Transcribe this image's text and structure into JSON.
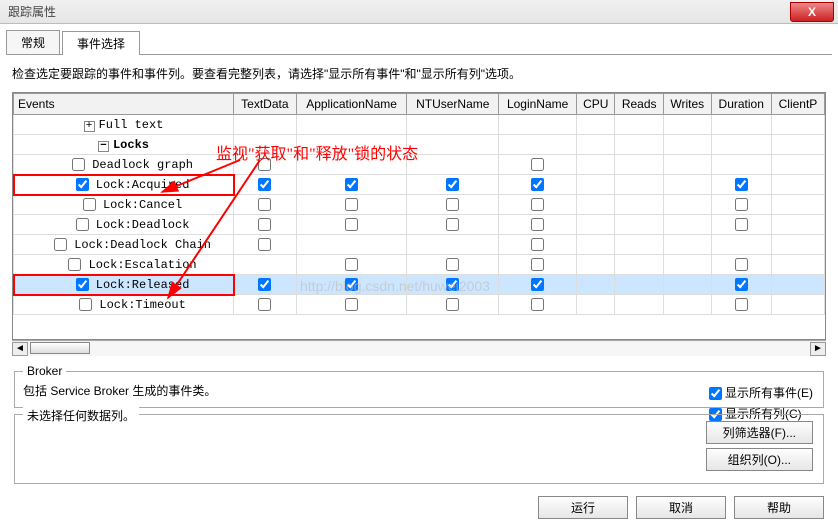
{
  "window": {
    "title": "跟踪属性",
    "close": "X"
  },
  "tabs": {
    "general": "常规",
    "events": "事件选择"
  },
  "instruction": "检查选定要跟踪的事件和事件列。要查看完整列表，请选择\"显示所有事件\"和\"显示所有列\"选项。",
  "columns": {
    "events": "Events",
    "textdata": "TextData",
    "app": "ApplicationName",
    "ntuser": "NTUserName",
    "login": "LoginName",
    "cpu": "CPU",
    "reads": "Reads",
    "writes": "Writes",
    "duration": "Duration",
    "clientp": "ClientP"
  },
  "rows": {
    "fulltext": "Full text",
    "locks": "Locks",
    "deadlock_graph": "Deadlock graph",
    "acquired": "Lock:Acquired",
    "cancel": "Lock:Cancel",
    "deadlock": "Lock:Deadlock",
    "deadlock_chain": "Lock:Deadlock Chain",
    "escalation": "Lock:Escalation",
    "released": "Lock:Released",
    "timeout": "Lock:Timeout"
  },
  "annotation": "监视\"获取\"和\"释放\"锁的状态",
  "watermark": "http://blog.csdn.net/huwei2003",
  "broker": {
    "legend": "Broker",
    "desc": "包括 Service Broker 生成的事件类。",
    "show_all_events": "显示所有事件(E)",
    "show_all_cols": "显示所有列(C)"
  },
  "nodata": {
    "text": "未选择任何数据列。",
    "col_filter": "列筛选器(F)...",
    "organize": "组织列(O)..."
  },
  "footer": {
    "run": "运行",
    "cancel": "取消",
    "help": "帮助"
  }
}
